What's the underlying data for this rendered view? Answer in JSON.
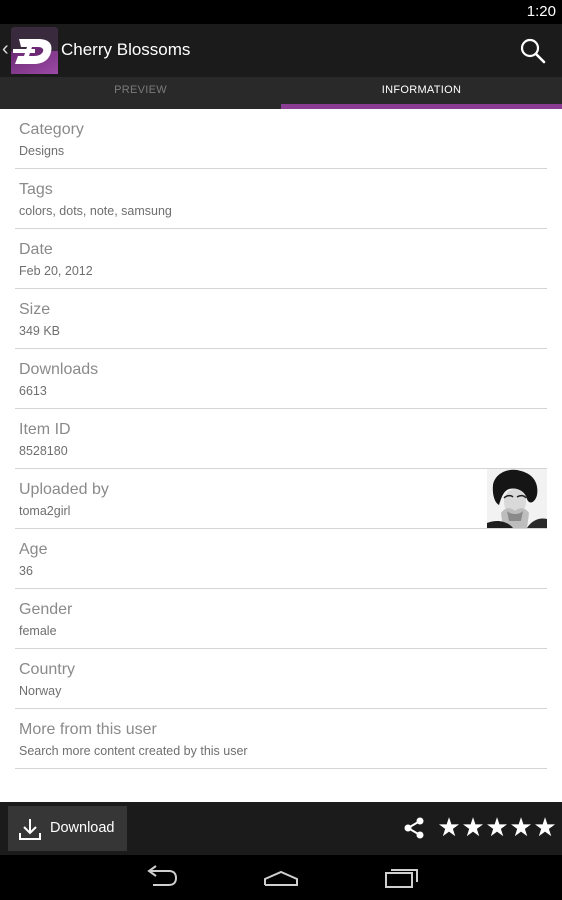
{
  "status_bar": {
    "time": "1:20"
  },
  "action_bar": {
    "title": "Cherry Blossoms",
    "logo_letter": "D",
    "logo_color": "#8b3d93"
  },
  "tabs": [
    {
      "label": "PREVIEW",
      "selected": false
    },
    {
      "label": "INFORMATION",
      "selected": true
    }
  ],
  "accent_color": "#8b3d93",
  "details": [
    {
      "label": "Category",
      "value": "Designs"
    },
    {
      "label": "Tags",
      "value": "colors, dots, note, samsung"
    },
    {
      "label": "Date",
      "value": "Feb 20, 2012"
    },
    {
      "label": "Size",
      "value": "349 KB"
    },
    {
      "label": "Downloads",
      "value": "6613"
    },
    {
      "label": "Item ID",
      "value": "8528180"
    },
    {
      "label": "Uploaded by",
      "value": "toma2girl"
    },
    {
      "label": "Age",
      "value": "36"
    },
    {
      "label": "Gender",
      "value": "female"
    },
    {
      "label": "Country",
      "value": "Norway"
    },
    {
      "label": "More from this user",
      "value": "Search more content created by this user"
    }
  ],
  "bottom_bar": {
    "download_label": "Download",
    "rating_stars": 5,
    "rating_max": 5
  },
  "icons": {
    "back": "chevron-left-icon",
    "search": "search-icon",
    "download": "download-icon",
    "share": "share-icon",
    "star": "star-icon",
    "nav_back": "back-arrow-icon",
    "nav_home": "home-icon",
    "nav_recents": "recents-icon"
  }
}
